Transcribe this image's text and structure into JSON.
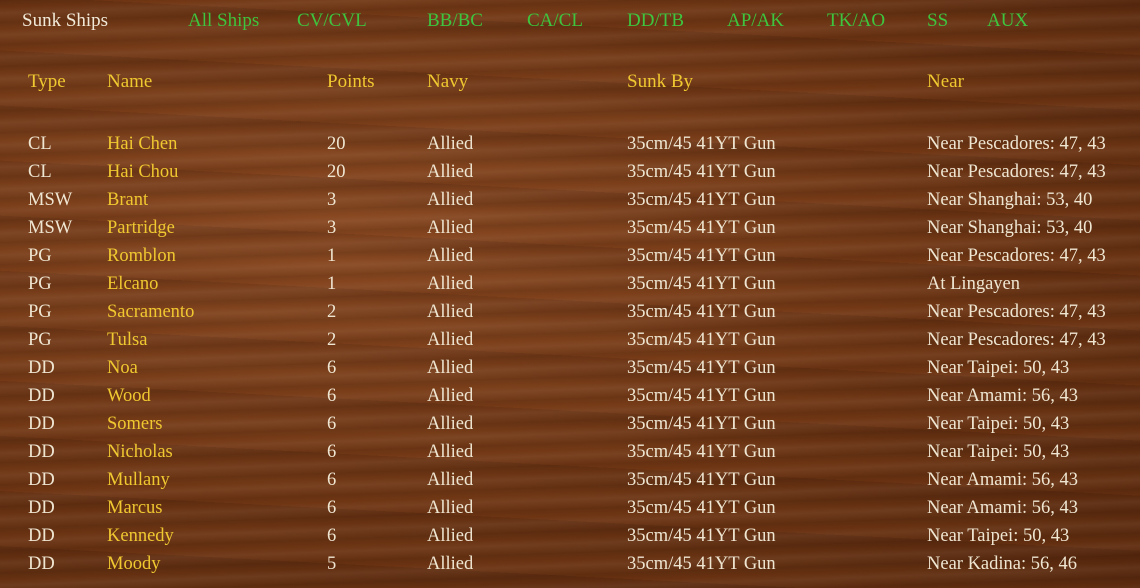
{
  "nav": {
    "title": "Sunk Ships",
    "tabs": [
      "All Ships",
      "CV/CVL",
      "BB/BC",
      "CA/CL",
      "DD/TB",
      "AP/AK",
      "TK/AO",
      "SS",
      "AUX"
    ]
  },
  "columns": {
    "type": "Type",
    "name": "Name",
    "points": "Points",
    "navy": "Navy",
    "sunk_by": "Sunk By",
    "near": "Near"
  },
  "rows": [
    {
      "type": "CL",
      "name": "Hai Chen",
      "points": "20",
      "navy": "Allied",
      "sunk_by": "35cm/45 41YT Gun",
      "near": "Near Pescadores: 47, 43"
    },
    {
      "type": "CL",
      "name": "Hai Chou",
      "points": "20",
      "navy": "Allied",
      "sunk_by": "35cm/45 41YT Gun",
      "near": "Near Pescadores: 47, 43"
    },
    {
      "type": "MSW",
      "name": "Brant",
      "points": "3",
      "navy": "Allied",
      "sunk_by": "35cm/45 41YT Gun",
      "near": "Near Shanghai: 53, 40"
    },
    {
      "type": "MSW",
      "name": "Partridge",
      "points": "3",
      "navy": "Allied",
      "sunk_by": "35cm/45 41YT Gun",
      "near": "Near Shanghai: 53, 40"
    },
    {
      "type": "PG",
      "name": "Romblon",
      "points": "1",
      "navy": "Allied",
      "sunk_by": "35cm/45 41YT Gun",
      "near": "Near Pescadores: 47, 43"
    },
    {
      "type": "PG",
      "name": "Elcano",
      "points": "1",
      "navy": "Allied",
      "sunk_by": "35cm/45 41YT Gun",
      "near": "At Lingayen"
    },
    {
      "type": "PG",
      "name": "Sacramento",
      "points": "2",
      "navy": "Allied",
      "sunk_by": "35cm/45 41YT Gun",
      "near": "Near Pescadores: 47, 43"
    },
    {
      "type": "PG",
      "name": "Tulsa",
      "points": "2",
      "navy": "Allied",
      "sunk_by": "35cm/45 41YT Gun",
      "near": "Near Pescadores: 47, 43"
    },
    {
      "type": "DD",
      "name": "Noa",
      "points": "6",
      "navy": "Allied",
      "sunk_by": "35cm/45 41YT Gun",
      "near": "Near Taipei: 50, 43"
    },
    {
      "type": "DD",
      "name": "Wood",
      "points": "6",
      "navy": "Allied",
      "sunk_by": "35cm/45 41YT Gun",
      "near": "Near Amami: 56, 43"
    },
    {
      "type": "DD",
      "name": "Somers",
      "points": "6",
      "navy": "Allied",
      "sunk_by": "35cm/45 41YT Gun",
      "near": "Near Taipei: 50, 43"
    },
    {
      "type": "DD",
      "name": "Nicholas",
      "points": "6",
      "navy": "Allied",
      "sunk_by": "35cm/45 41YT Gun",
      "near": "Near Taipei: 50, 43"
    },
    {
      "type": "DD",
      "name": "Mullany",
      "points": "6",
      "navy": "Allied",
      "sunk_by": "35cm/45 41YT Gun",
      "near": "Near Amami: 56, 43"
    },
    {
      "type": "DD",
      "name": "Marcus",
      "points": "6",
      "navy": "Allied",
      "sunk_by": "35cm/45 41YT Gun",
      "near": "Near Amami: 56, 43"
    },
    {
      "type": "DD",
      "name": "Kennedy",
      "points": "6",
      "navy": "Allied",
      "sunk_by": "35cm/45 41YT Gun",
      "near": "Near Taipei: 50, 43"
    },
    {
      "type": "DD",
      "name": "Moody",
      "points": "5",
      "navy": "Allied",
      "sunk_by": "35cm/45 41YT Gun",
      "near": "Near Kadina: 56, 46"
    }
  ]
}
